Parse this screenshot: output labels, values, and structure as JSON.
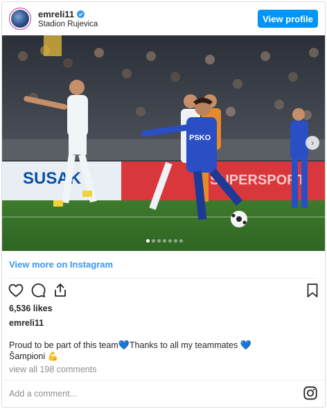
{
  "header": {
    "username": "emreli11",
    "location": "Stadion Rujevica",
    "view_profile_label": "View profile"
  },
  "photo": {
    "banners": [
      "SUSAK",
      "SUPERSPORT"
    ],
    "jersey_text": "PSKO",
    "carousel": {
      "total": 7,
      "active": 1
    }
  },
  "view_more_label": "View more on Instagram",
  "likes_label": "6,536 likes",
  "caption": {
    "username": "emreli11",
    "line1_text": "Proud to be part of this team",
    "line1_text2": "Thanks to all my teammates",
    "emoji_heart": "💙",
    "line2_text": "Šampioni",
    "emoji_arm": "💪"
  },
  "comments_link": "view all 198 comments",
  "add_comment_placeholder": "Add a comment...",
  "colors": {
    "accent_blue": "#0095f6",
    "link_blue": "#3897f0",
    "muted_gray": "#8e8e8e",
    "border_gray": "#dbdbdb"
  },
  "icons": [
    "verified-badge-icon",
    "heart-icon",
    "comment-icon",
    "share-icon",
    "bookmark-icon",
    "instagram-icon",
    "chevron-right-icon"
  ]
}
